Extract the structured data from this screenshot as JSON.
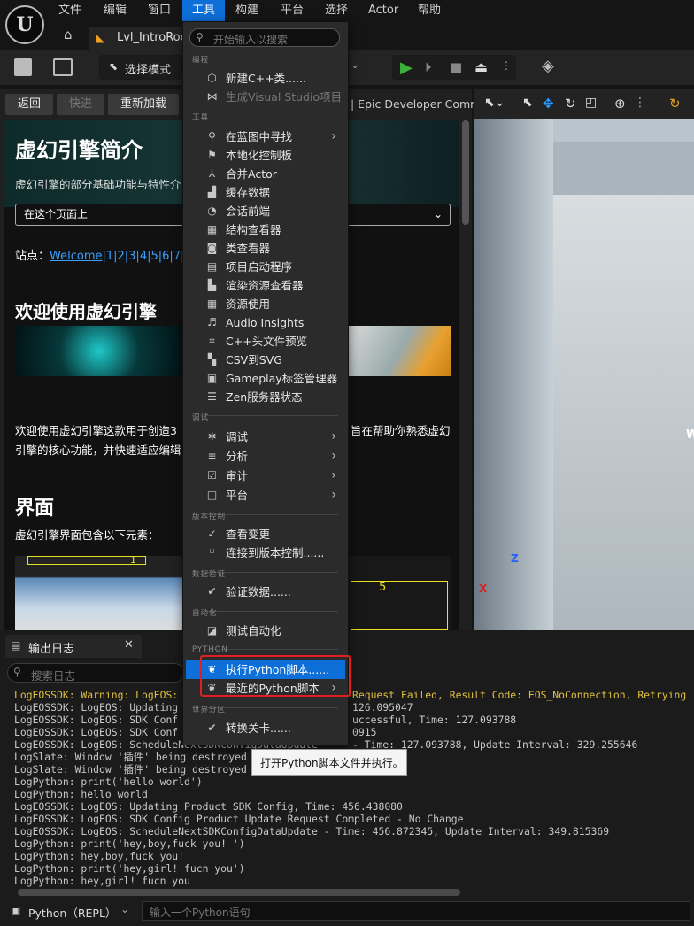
{
  "menubar": {
    "logo": "U",
    "items": [
      "文件",
      "编辑",
      "窗口",
      "工具",
      "构建",
      "平台",
      "选择",
      "Actor",
      "帮助"
    ]
  },
  "tabs": {
    "level": "Lvl_IntroRoom"
  },
  "toolbar": {
    "mode": "选择模式"
  },
  "docbar": {
    "back": "返回",
    "forward": "快进",
    "reload": "重新加载",
    "url_tail": "| Epic Developer Comm"
  },
  "doc": {
    "title": "虚幻引擎简介",
    "subtitle": "虚幻引擎的部分基础功能与特性介",
    "select": "在这个页面上",
    "sites_label": "站点：",
    "sites_link": "Welcome",
    "sites_nums": "|1|2|3|4|5|6|7|8",
    "h2": "欢迎使用虚幻引擎",
    "para1": "欢迎使用虚幻引擎这款用于创造3",
    "para1_right": "旨在帮助你熟悉虚幻",
    "para2": "引擎的核心功能，并快速适应编辑",
    "h3": "界面",
    "para3": "虚幻引擎界面包含以下元素：",
    "num1": "1",
    "num5": "5"
  },
  "viewport": {
    "axis_z": "Z",
    "axis_x": "X",
    "wall_text": "W"
  },
  "dropdown": {
    "search_placeholder": "开始输入以搜索",
    "sections": {
      "s1": "编程",
      "s2": "工具",
      "s3": "调试",
      "s4": "版本控制",
      "s5": "数据验证",
      "s6": "自动化",
      "s7": "PYTHON",
      "s8": "世界分区"
    },
    "prog": [
      "新建C++类......",
      "生成Visual Studio项目"
    ],
    "tools": [
      "在蓝图中寻找",
      "本地化控制板",
      "合并Actor",
      "缓存数据",
      "会话前端",
      "结构查看器",
      "类查看器",
      "项目启动程序",
      "渲染资源查看器",
      "资源使用",
      "Audio Insights",
      "C++头文件预览",
      "CSV到SVG",
      "Gameplay标签管理器",
      "Zen服务器状态"
    ],
    "debug": [
      "调试",
      "分析",
      "审计",
      "平台"
    ],
    "vc": [
      "查看变更",
      "连接到版本控制......"
    ],
    "dv": [
      "验证数据......"
    ],
    "auto": [
      "测试自动化"
    ],
    "py": [
      "执行Python脚本......",
      "最近的Python脚本"
    ],
    "wp": [
      "转换关卡......"
    ]
  },
  "tooltip": "打开Python脚本文件并执行。",
  "log": {
    "tab": "输出日志",
    "search_placeholder": "搜索日志",
    "lines": [
      "LogEOSSDK: Warning: LogEOS:",
      "LogEOSSDK: LogEOS: Updating",
      "LogEOSSDK: LogEOS: SDK Conf",
      "LogEOSSDK: LogEOS: SDK Conf",
      "LogEOSSDK: LogEOS: ScheduleNextSDKConfigDataUpdate",
      "LogSlate: Window '插件' being destroyed",
      "LogSlate: Window '插件' being destroyed",
      "LogPython: print('hello world')",
      "LogPython: hello world",
      "LogEOSSDK: LogEOS: Updating Product SDK Config, Time: 456.438080",
      "LogEOSSDK: LogEOS: SDK Config Product Update Request Completed - No Change",
      "LogEOSSDK: LogEOS: ScheduleNextSDKConfigDataUpdate - Time: 456.872345, Update Interval: 349.815369",
      "LogPython: print('hey,boy,fuck you! ')",
      "LogPython: hey,boy,fuck you!",
      "LogPython: print('hey,girl! fucn you')",
      "LogPython: hey,girl! fucn you"
    ],
    "right": [
      "Request Failed, Result Code: EOS_NoConnection, Retrying",
      "126.095047",
      "uccessful, Time: 127.093788",
      "0915",
      "- Time: 127.093788, Update Interval: 329.255646"
    ],
    "repl": "Python（REPL）",
    "input_placeholder": "输入一个Python语句"
  },
  "colors": {
    "accent": "#0e6fd8",
    "warning": "#e0c040",
    "highlight": "#e02020",
    "link": "#3aa0ff"
  }
}
